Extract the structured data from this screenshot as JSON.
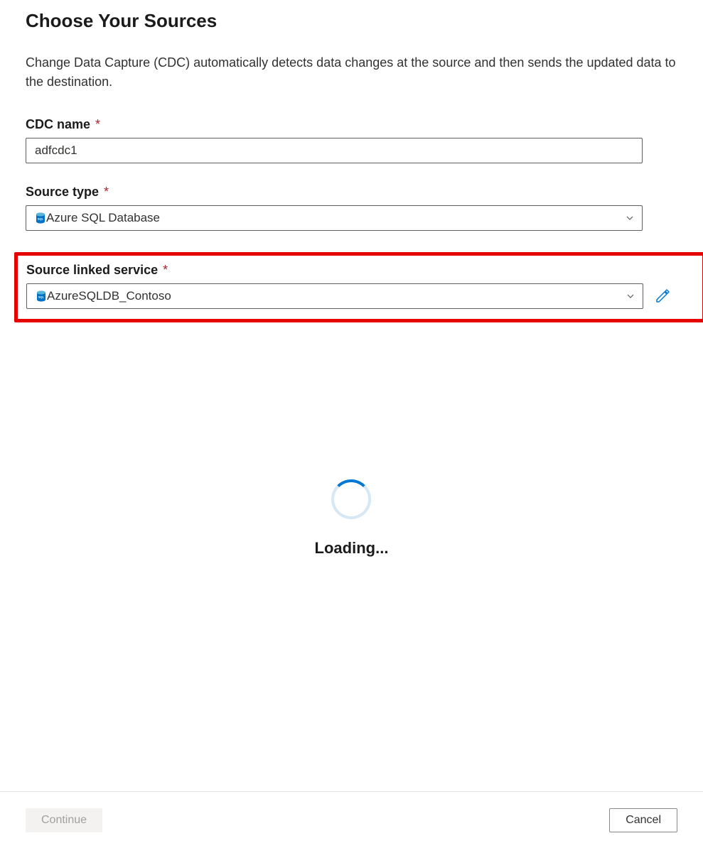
{
  "header": {
    "title": "Choose Your Sources",
    "description": "Change Data Capture (CDC) automatically detects data changes at the source and then sends the updated data to the destination."
  },
  "fields": {
    "cdc_name": {
      "label": "CDC name",
      "value": "adfcdc1"
    },
    "source_type": {
      "label": "Source type",
      "value": "Azure SQL Database"
    },
    "source_linked_service": {
      "label": "Source linked service",
      "value": "AzureSQLDB_Contoso"
    }
  },
  "loading": {
    "text": "Loading..."
  },
  "footer": {
    "continue_label": "Continue",
    "cancel_label": "Cancel"
  },
  "icons": {
    "sql_color": "#0072c6",
    "edit_color": "#0078d4"
  }
}
